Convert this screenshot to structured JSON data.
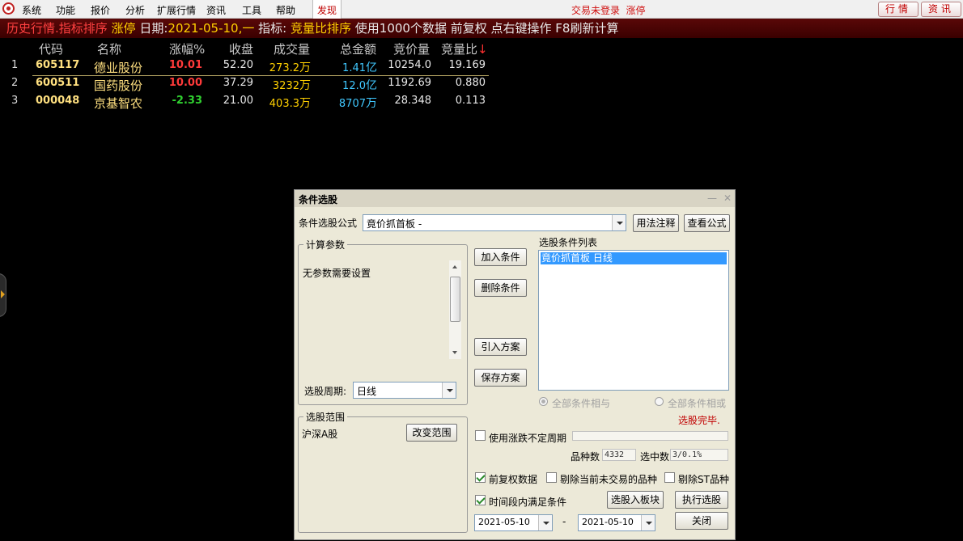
{
  "menubar": {
    "items": [
      "系统",
      "功能",
      "报价",
      "分析",
      "扩展行情",
      "资讯",
      "工具",
      "帮助"
    ],
    "active_item": "发现",
    "login_status": "交易未登录",
    "limit_status": "涨停",
    "tabs": [
      "行情",
      "资讯"
    ]
  },
  "titlebar": {
    "mode": "历史行情.指标排序",
    "filter": "涨停",
    "date_label": "日期:",
    "date_value": "2021-05-10,一",
    "indicator_label": "指标:",
    "indicator_value": "竞量比排序",
    "info": "使用1000个数据 前复权 点右键操作 F8刷新计算"
  },
  "table": {
    "headers": [
      "代码",
      "名称",
      "涨幅%",
      "收盘",
      "成交量",
      "总金额",
      "竞价量",
      "竞量比"
    ],
    "sort_arrow": "↓",
    "rows": [
      {
        "idx": "1",
        "code": "605117",
        "name": "德业股份",
        "change": "10.01",
        "close": "52.20",
        "volume": "273.2",
        "volume_unit": "万",
        "amount": "1.41",
        "amount_unit": "亿",
        "auction_vol": "10254.0",
        "auction_ratio": "19.169",
        "direction": "up"
      },
      {
        "idx": "2",
        "code": "600511",
        "name": "国药股份",
        "change": "10.00",
        "close": "37.29",
        "volume": "3232",
        "volume_unit": "万",
        "amount": "12.0",
        "amount_unit": "亿",
        "auction_vol": "1192.69",
        "auction_ratio": "0.880",
        "direction": "up"
      },
      {
        "idx": "3",
        "code": "000048",
        "name": "京基智农",
        "change": "-2.33",
        "close": "21.00",
        "volume": "403.3",
        "volume_unit": "万",
        "amount": "8707",
        "amount_unit": "万",
        "auction_vol": "28.348",
        "auction_ratio": "0.113",
        "direction": "down"
      }
    ]
  },
  "dialog": {
    "title": "条件选股",
    "formula_label": "条件选股公式",
    "formula_value": "竟价抓首板    -",
    "usage_button": "用法注释",
    "view_formula_button": "查看公式",
    "params_group": "计算参数",
    "params_text": "无参数需要设置",
    "period_label": "选股周期:",
    "period_value": "日线",
    "range_group": "选股范围",
    "range_value": "沪深A股",
    "change_range_button": "改变范围",
    "add_condition_button": "加入条件",
    "delete_condition_button": "删除条件",
    "import_plan_button": "引入方案",
    "save_plan_button": "保存方案",
    "condition_list_label": "选股条件列表",
    "condition_list": [
      "竟价抓首板  日线"
    ],
    "radio_and": "全部条件相与",
    "radio_or": "全部条件相或",
    "status_done": "选股完毕.",
    "use_variable_period": "使用涨跌不定周期",
    "count_label": "品种数",
    "count_value": "4332",
    "selected_label": "选中数",
    "selected_value": "3/0.1%",
    "adjust_label": "前复权数据",
    "exclude_untraded_label": "剔除当前未交易的品种",
    "exclude_st_label": "剔除ST品种",
    "timerange_label": "时间段内满足条件",
    "to_board_button": "选股入板块",
    "execute_button": "执行选股",
    "close_button": "关闭",
    "date_from": "2021-05-10",
    "date_sep": "-",
    "date_to": "2021-05-10"
  }
}
